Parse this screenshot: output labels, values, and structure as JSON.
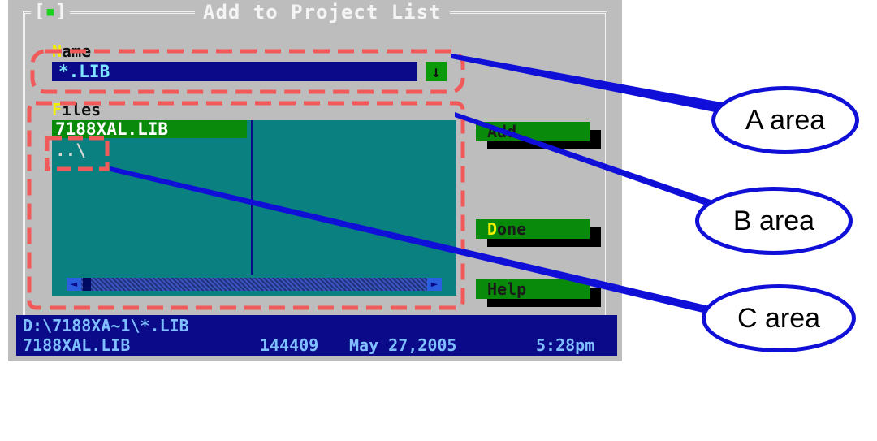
{
  "dialog": {
    "title": "Add to Project List",
    "close_box": "[",
    "close_mark": "▪",
    "close_box_end": "]"
  },
  "name_field": {
    "label_hot": "N",
    "label_rest": "ame",
    "value": "*.LIB",
    "dropdown_glyph": "↓"
  },
  "files": {
    "label_hot": "F",
    "label_rest": "iles",
    "items": [
      "7188XAL.LIB",
      "..\\"
    ],
    "scroll_left": "◄",
    "scroll_right": "►"
  },
  "buttons": {
    "add": "Add",
    "done_hot": "D",
    "done_rest": "one",
    "help": "Help"
  },
  "status": {
    "path": "D:\\7188XA~1\\*.LIB",
    "file_name": "7188XAL.LIB",
    "file_size": "144409",
    "file_date": "May 27,2005",
    "file_time": "5:28pm"
  },
  "annotations": {
    "a_area": "A area",
    "b_area": "B area",
    "c_area": "C area",
    "highlight_color": "#f05a5a",
    "line_color": "#0f0fd8"
  }
}
